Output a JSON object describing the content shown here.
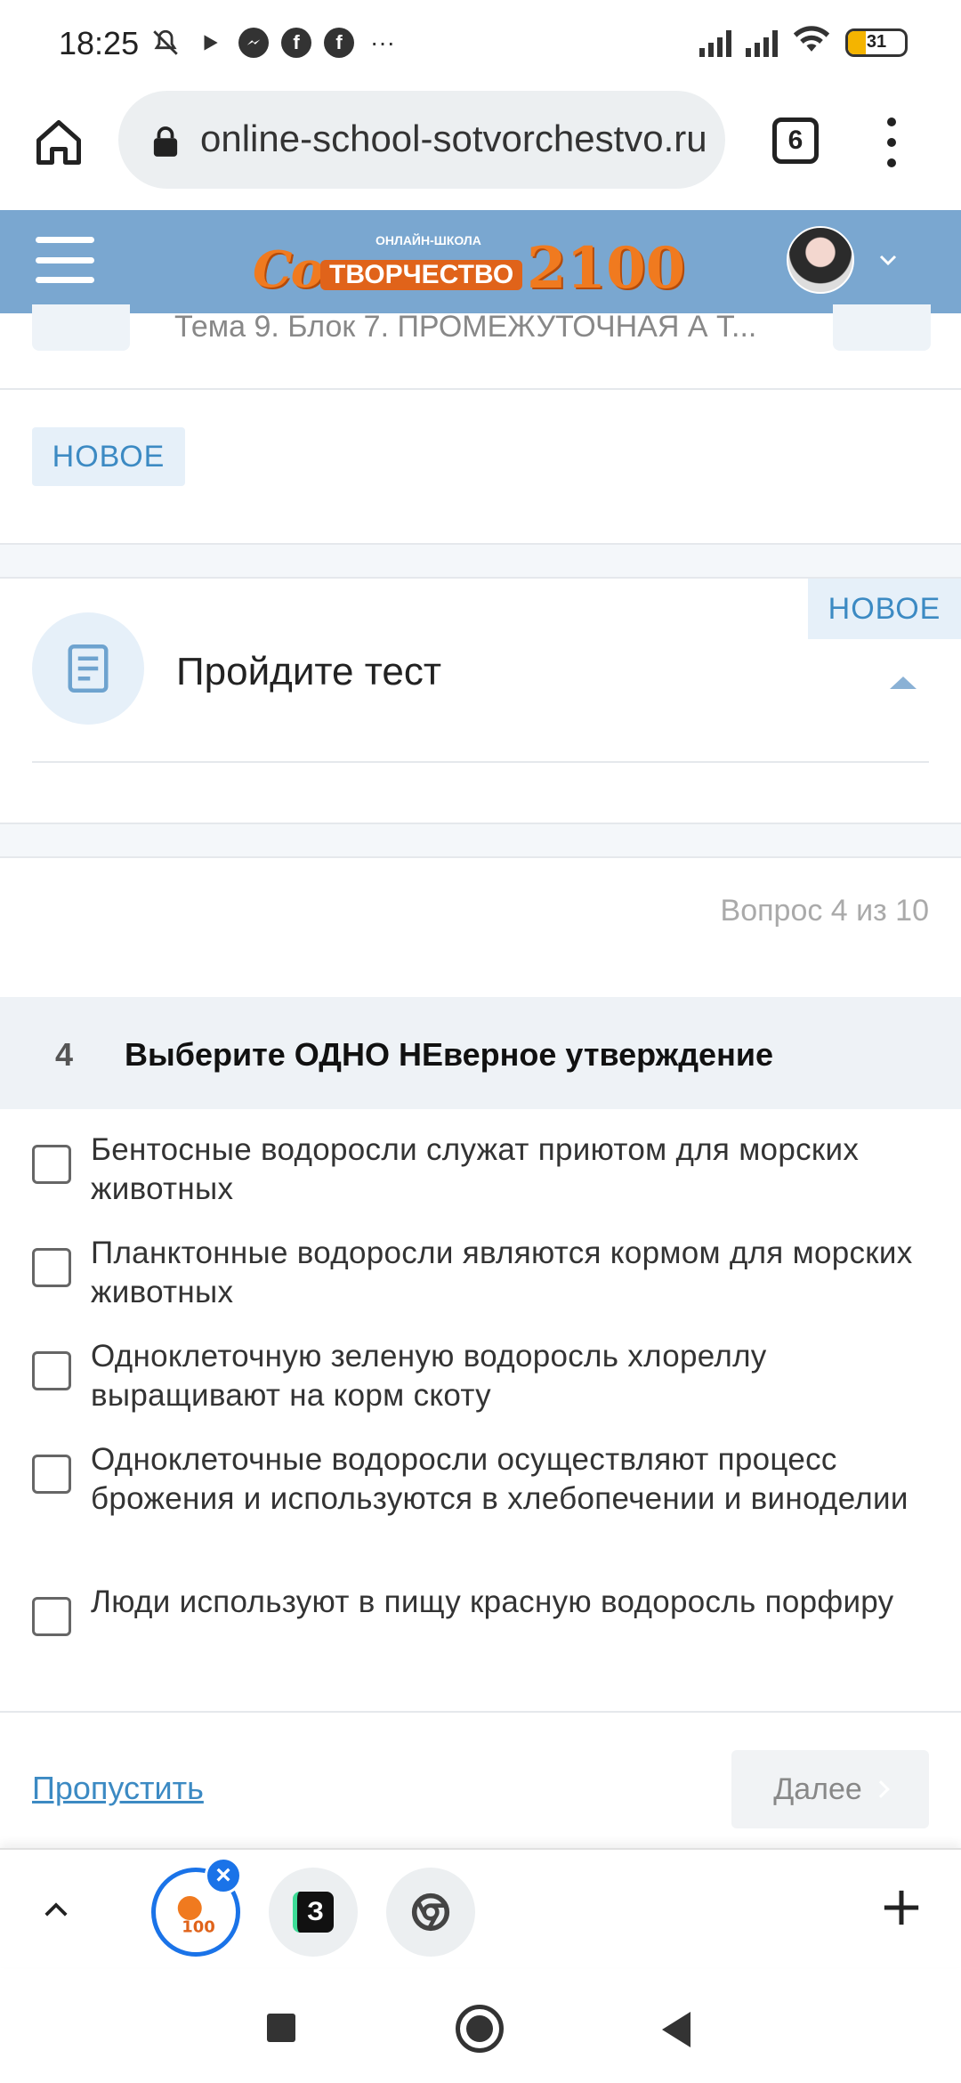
{
  "status_bar": {
    "time": "18:25",
    "battery_level": "31",
    "icons": [
      "mute-icon",
      "play-icon",
      "messenger-icon",
      "facebook-icon",
      "facebook-icon",
      "more-icon",
      "signal-icon",
      "signal-icon",
      "wifi-icon",
      "battery-icon"
    ],
    "more": "···"
  },
  "browser": {
    "url": "online-school-sotvorchestvo.ru",
    "tab_count": "6"
  },
  "site_header": {
    "logo_small_text": "ОНЛАЙН-ШКОЛА",
    "logo_main": "Co",
    "logo_word": "ТВОРЧЕСТВО",
    "logo_number": "2100"
  },
  "breadcrumb": {
    "text": "Тема 9. Блок 7. ПРОМЕЖУТОЧНАЯ А Т..."
  },
  "badge_new": "НОВОЕ",
  "lesson": {
    "title": "Пройдите тест",
    "badge": "НОВОЕ"
  },
  "question": {
    "counter": "Вопрос 4 из 10",
    "number": "4",
    "text": "Выберите ОДНО НЕверное утверждение",
    "options": [
      {
        "label": "Бентосные водоросли служат приютом для морских животных",
        "checked": false
      },
      {
        "label": "Планктонные водоросли являются кормом для морских животных",
        "checked": false
      },
      {
        "label": "Одноклеточную зеленую водоросль хлореллу выращивают на корм скоту",
        "checked": false
      },
      {
        "label": "Одноклеточные водоросли осуществляют процесс брожения и используются в хлебопечении и виноделии",
        "checked": false
      },
      {
        "label": "Люди используют в пищу красную водоросль порфиру",
        "checked": false
      }
    ]
  },
  "actions": {
    "skip": "Пропустить",
    "next": "Далее"
  },
  "tab_strip": {
    "tabs": [
      "site-tab",
      "z-app-tab",
      "chrome-tab"
    ],
    "second_tab_letter": "З",
    "close": "×"
  },
  "colors": {
    "header_bg": "#7aa7d0",
    "accent_blue": "#3c8ac3",
    "badge_bg": "#e6f0f9",
    "logo_orange": "#f07a1f",
    "chrome_blue": "#1a73e8"
  }
}
